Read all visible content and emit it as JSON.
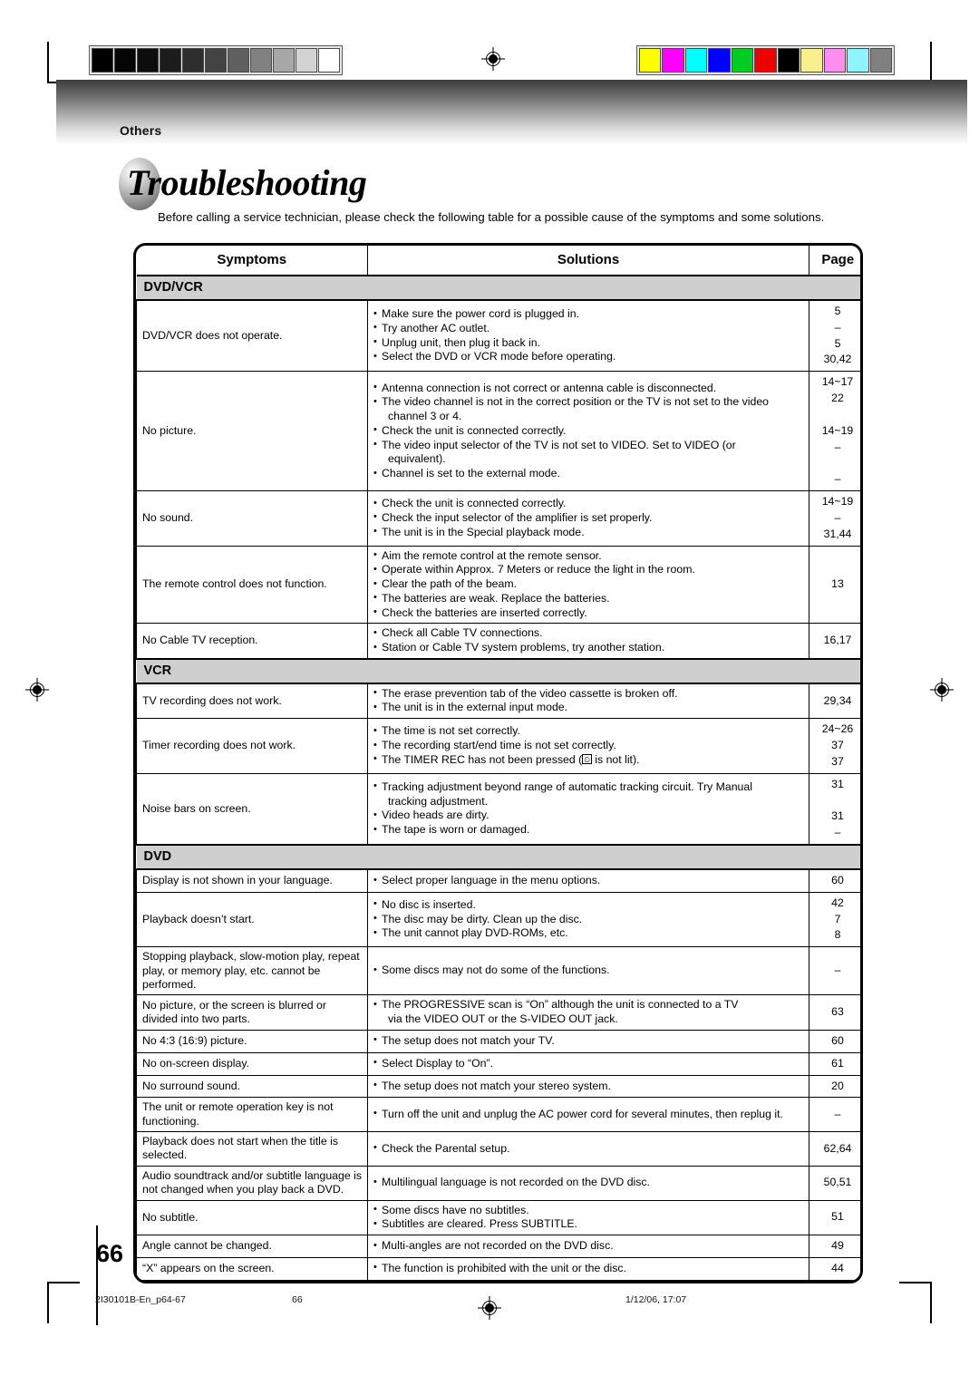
{
  "header": {
    "tab_label": "Others"
  },
  "title": "Troubleshooting",
  "intro": "Before calling a service technician, please check the following table for a possible cause of the symptoms and some solutions.",
  "table": {
    "columns": [
      "Symptoms",
      "Solutions",
      "Page"
    ],
    "sections": [
      {
        "name": "DVD/VCR",
        "rows": [
          {
            "symptom": "DVD/VCR does not operate.",
            "solutions": [
              "Make sure the power cord is plugged in.",
              "Try another AC outlet.",
              "Unplug unit, then plug it back in.",
              "Select the DVD or VCR mode before operating."
            ],
            "pages": "5\n–\n5\n30,42"
          },
          {
            "symptom": "No picture.",
            "solutions": [
              "Antenna connection is not correct or antenna cable is disconnected.",
              "The video channel is not in the correct position or the TV is not set to the video",
              "channel 3 or 4.",
              "Check the unit is connected correctly.",
              "The video input selector of the TV is not set to VIDEO. Set to VIDEO (or",
              "equivalent).",
              "Channel is set to the external mode."
            ],
            "pages": "14~17\n22\n\n14~19\n–\n\n–"
          },
          {
            "symptom": "No sound.",
            "solutions": [
              "Check the unit is connected correctly.",
              "Check the input selector of the amplifier is set properly.",
              "The unit is in the Special playback mode."
            ],
            "pages": "14~19\n–\n31,44"
          },
          {
            "symptom": "The remote control does not function.",
            "solutions": [
              "Aim the remote control at the remote sensor.",
              "Operate within Approx. 7 Meters or reduce the light in the room.",
              "Clear the path of the beam.",
              "The batteries are weak. Replace the batteries.",
              "Check the batteries are inserted correctly."
            ],
            "pages": "13"
          },
          {
            "symptom": "No Cable TV reception.",
            "solutions": [
              "Check all Cable TV connections.",
              "Station or Cable TV system problems, try another station."
            ],
            "pages": "16,17"
          }
        ]
      },
      {
        "name": "VCR",
        "rows": [
          {
            "symptom": "TV recording does not work.",
            "solutions": [
              "The erase prevention tab of the video cassette is broken off.",
              "The unit is in the external input mode."
            ],
            "pages": "29,34"
          },
          {
            "symptom": "Timer recording does not work.",
            "solutions": [
              "The time is not set correctly.",
              "The recording start/end time is not set correctly.",
              "The TIMER REC has not been pressed (⤉0 is not lit)."
            ],
            "pages": "24~26\n37\n37"
          },
          {
            "symptom": "Noise bars on screen.",
            "solutions": [
              "Tracking adjustment beyond range of automatic tracking circuit. Try Manual",
              "tracking adjustment.",
              "Video heads are dirty.",
              "The tape is worn or damaged."
            ],
            "pages": "31\n\n31\n–"
          }
        ]
      },
      {
        "name": "DVD",
        "rows": [
          {
            "symptom": "Display is not shown in your language.",
            "solutions": [
              "Select proper language in the menu options."
            ],
            "pages": "60"
          },
          {
            "symptom": "Playback doesn’t start.",
            "solutions": [
              "No disc is inserted.",
              "The disc may be dirty. Clean up the disc.",
              "The unit cannot play DVD-ROMs, etc."
            ],
            "pages": "42\n7\n8"
          },
          {
            "symptom": "Stopping playback, slow-motion play, repeat play, or memory play, etc. cannot be performed.",
            "solutions": [
              "Some discs may not do some of the functions."
            ],
            "pages": "–"
          },
          {
            "symptom": "No picture, or the screen is blurred or divided into two parts.",
            "solutions": [
              "The PROGRESSIVE scan is “On” although the unit is connected to a TV",
              "via the VIDEO OUT or the S-VIDEO OUT jack."
            ],
            "pages": "63"
          },
          {
            "symptom": "No 4:3 (16:9) picture.",
            "solutions": [
              "The setup does not match your TV."
            ],
            "pages": "60"
          },
          {
            "symptom": "No on-screen display.",
            "solutions": [
              "Select Display to “On”."
            ],
            "pages": "61"
          },
          {
            "symptom": "No surround sound.",
            "solutions": [
              "The setup does not match your stereo system."
            ],
            "pages": "20"
          },
          {
            "symptom": "The unit or remote operation key is not functioning.",
            "solutions": [
              "Turn off the unit and unplug the AC power cord for several minutes, then replug it."
            ],
            "pages": "–"
          },
          {
            "symptom": "Playback does not start when the title is selected.",
            "solutions": [
              "Check the Parental setup."
            ],
            "pages": "62,64"
          },
          {
            "symptom": "Audio soundtrack and/or subtitle language is not changed when you play back a DVD.",
            "solutions": [
              "Multilingual language is not recorded on the DVD disc."
            ],
            "pages": "50,51"
          },
          {
            "symptom": "No subtitle.",
            "solutions": [
              "Some discs have no subtitles.",
              "Subtitles are cleared. Press SUBTITLE."
            ],
            "pages": "51"
          },
          {
            "symptom": "Angle cannot be changed.",
            "solutions": [
              "Multi-angles are not recorded on the DVD disc."
            ],
            "pages": "49"
          },
          {
            "symptom": "“X” appears on the screen.",
            "solutions": [
              "The function is prohibited with the unit or the disc."
            ],
            "pages": "44"
          }
        ]
      }
    ]
  },
  "page_number": "66",
  "footer": {
    "file_name": "2I30101B-En_p64-67",
    "page": "66",
    "date": "1/12/06, 17:07"
  },
  "calibration": {
    "grayscale": [
      "#000000",
      "#050505",
      "#0d0d0d",
      "#1c1c1c",
      "#2d2d2d",
      "#434343",
      "#5f5f5f",
      "#818181",
      "#a7a7a7",
      "#d3d3d3",
      "#ffffff"
    ],
    "colors": [
      "#ffff00",
      "#ff00ff",
      "#00ffff",
      "#0000ff",
      "#00cc22",
      "#ee0000",
      "#000000",
      "#faef8f",
      "#ff8ef0",
      "#8ef5ff",
      "#808080"
    ]
  }
}
